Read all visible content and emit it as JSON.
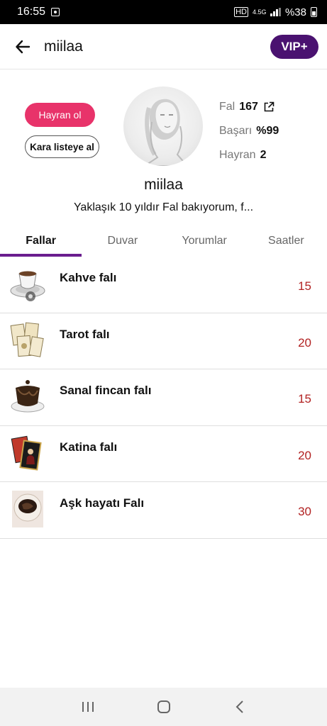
{
  "status_bar": {
    "time": "16:55",
    "network": "4.5G",
    "battery": "%38"
  },
  "header": {
    "title": "miilaa",
    "vip_label": "VIP+"
  },
  "profile": {
    "follow_label": "Hayran ol",
    "blacklist_label": "Kara listeye al",
    "stats": [
      {
        "label": "Fal",
        "value": "167"
      },
      {
        "label": "Başarı",
        "value": "%99"
      },
      {
        "label": "Hayran",
        "value": "2"
      }
    ],
    "username": "miilaa",
    "bio": "Yaklaşık 10 yıldır Fal bakıyorum, f..."
  },
  "tabs": [
    {
      "label": "Fallar",
      "active": true
    },
    {
      "label": "Duvar"
    },
    {
      "label": "Yorumlar"
    },
    {
      "label": "Saatler"
    }
  ],
  "items": [
    {
      "name": "Kahve falı",
      "price": "15",
      "icon": "coffee-cup-icon"
    },
    {
      "name": "Tarot falı",
      "price": "20",
      "icon": "tarot-cards-icon"
    },
    {
      "name": "Sanal fincan falı",
      "price": "15",
      "icon": "virtual-cup-icon"
    },
    {
      "name": "Katina falı",
      "price": "20",
      "icon": "katina-cards-icon"
    },
    {
      "name": "Aşk hayatı Falı",
      "price": "30",
      "icon": "love-cup-icon"
    }
  ],
  "colors": {
    "accent": "#4a1270",
    "tab_indicator": "#6a1e8e",
    "follow": "#e8336a",
    "price": "#b22222"
  }
}
